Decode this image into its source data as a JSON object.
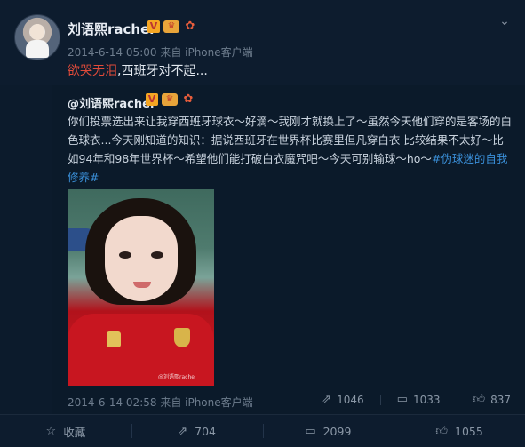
{
  "post": {
    "username": "刘语熙rachel",
    "meta": "2014-6-14 05:00 来自 iPhone客户端",
    "text_highlight": "欲哭无泪",
    "text_rest": ",西班牙对不起..."
  },
  "repost": {
    "username": "@刘语熙rachel",
    "body": "你们投票选出来让我穿西班牙球衣～好滴～我刚才就换上了～虽然今天他们穿的是客场的白色球衣...今天刚知道的知识：据说西班牙在世界杯比赛里但凡穿白衣 比较结果不太好～比如94年和98年世界杯～希望他们能打破白衣魔咒吧～今天可别输球～ho～",
    "tag": "#伪球迷的自我修养#",
    "photo_watermark": "@刘语熙rachel",
    "meta": "2014-6-14 02:58 来自 iPhone客户端",
    "reposts": "1046",
    "comments": "1033",
    "likes": "837"
  },
  "actions": {
    "favorite": "收藏",
    "repost": "704",
    "comment": "2099",
    "like": "1055"
  },
  "icons": {
    "collapse": "chevron-down-icon",
    "favorite": "star-icon",
    "repost": "repost-icon",
    "comment": "comment-icon",
    "like": "thumb-up-icon"
  },
  "colors": {
    "background": "#0c1b2c",
    "highlight": "#e24b3a",
    "link": "#3a8fd8"
  }
}
